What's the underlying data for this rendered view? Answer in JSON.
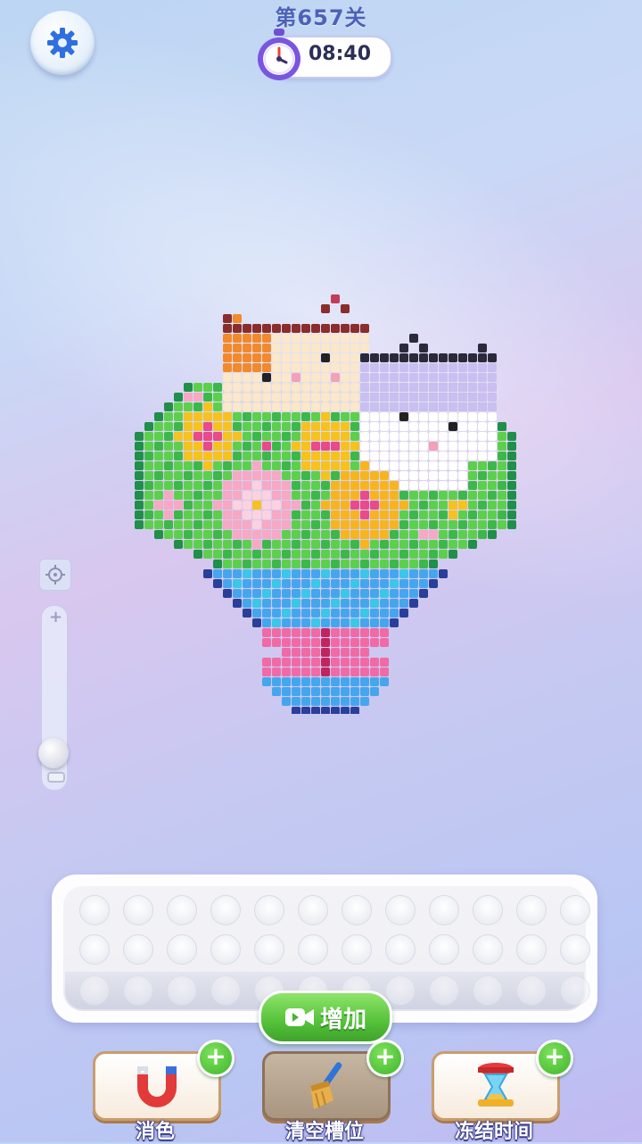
{
  "header": {
    "level_title": "第657关",
    "timer": "08:40"
  },
  "icons": {
    "settings": "gear-icon",
    "timer": "stopwatch-icon",
    "locate": "crosshair-icon",
    "video": "video-camera-icon",
    "magnet": "magnet-icon",
    "broom": "broom-icon",
    "freeze": "hourglass-icon"
  },
  "zoom": {
    "plus_label": "+",
    "level": 0
  },
  "slot_tray": {
    "rows": 3,
    "slots_per_row": 12,
    "filled": 0
  },
  "add_button": {
    "label": "增加"
  },
  "tools": [
    {
      "label": "消色",
      "badge": "+"
    },
    {
      "label": "清空槽位",
      "badge": "+"
    },
    {
      "label": "冻结时间",
      "badge": "+"
    }
  ],
  "colors": {
    "accent_green": "#55c13a",
    "title_blue": "#4c62b8"
  }
}
